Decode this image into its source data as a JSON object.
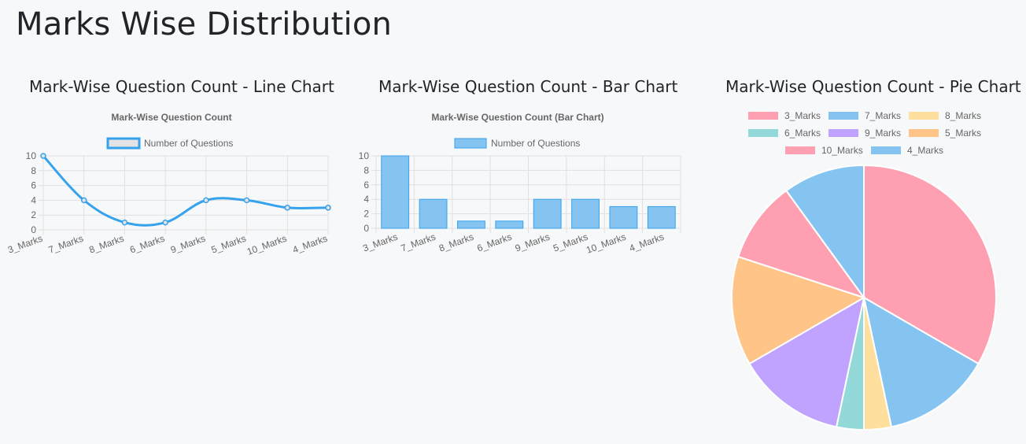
{
  "page": {
    "title": "Marks Wise Distribution"
  },
  "panels": {
    "line_title": "Mark-Wise Question Count - Line Chart",
    "bar_title": "Mark-Wise Question Count - Bar Chart",
    "pie_title": "Mark-Wise Question Count - Pie Chart"
  },
  "colors": {
    "line": "#36a2eb",
    "line_fill": "#e3e3e3",
    "bar_fill": "#85c4f0",
    "bar_border": "#36a2eb",
    "grid": "#e0e0e0",
    "text": "#666666",
    "pie": [
      "#ff9fb2",
      "#85c4f0",
      "#ffdf9e",
      "#94d9d9",
      "#c0a3ff",
      "#ffc488",
      "#ff9fb2",
      "#85c4f0"
    ]
  },
  "chart_data": [
    {
      "type": "line",
      "title": "Mark-Wise Question Count",
      "categories": [
        "3_Marks",
        "7_Marks",
        "8_Marks",
        "6_Marks",
        "9_Marks",
        "5_Marks",
        "10_Marks",
        "4_Marks"
      ],
      "series": [
        {
          "name": "Number of Questions",
          "values": [
            10,
            4,
            1,
            1,
            4,
            4,
            3,
            3
          ]
        }
      ],
      "ylim": [
        0,
        10
      ],
      "yticks": [
        0,
        2,
        4,
        6,
        8,
        10
      ],
      "legend": "top",
      "grid": true
    },
    {
      "type": "bar",
      "title": "Mark-Wise Question Count (Bar Chart)",
      "categories": [
        "3_Marks",
        "7_Marks",
        "8_Marks",
        "6_Marks",
        "9_Marks",
        "5_Marks",
        "10_Marks",
        "4_Marks"
      ],
      "series": [
        {
          "name": "Number of Questions",
          "values": [
            10,
            4,
            1,
            1,
            4,
            4,
            3,
            3
          ]
        }
      ],
      "ylim": [
        0,
        10
      ],
      "yticks": [
        0,
        2,
        4,
        6,
        8,
        10
      ],
      "legend": "top",
      "grid": true
    },
    {
      "type": "pie",
      "categories": [
        "3_Marks",
        "7_Marks",
        "8_Marks",
        "6_Marks",
        "9_Marks",
        "5_Marks",
        "10_Marks",
        "4_Marks"
      ],
      "values": [
        10,
        4,
        1,
        1,
        4,
        4,
        3,
        3
      ],
      "legend": "top"
    }
  ]
}
